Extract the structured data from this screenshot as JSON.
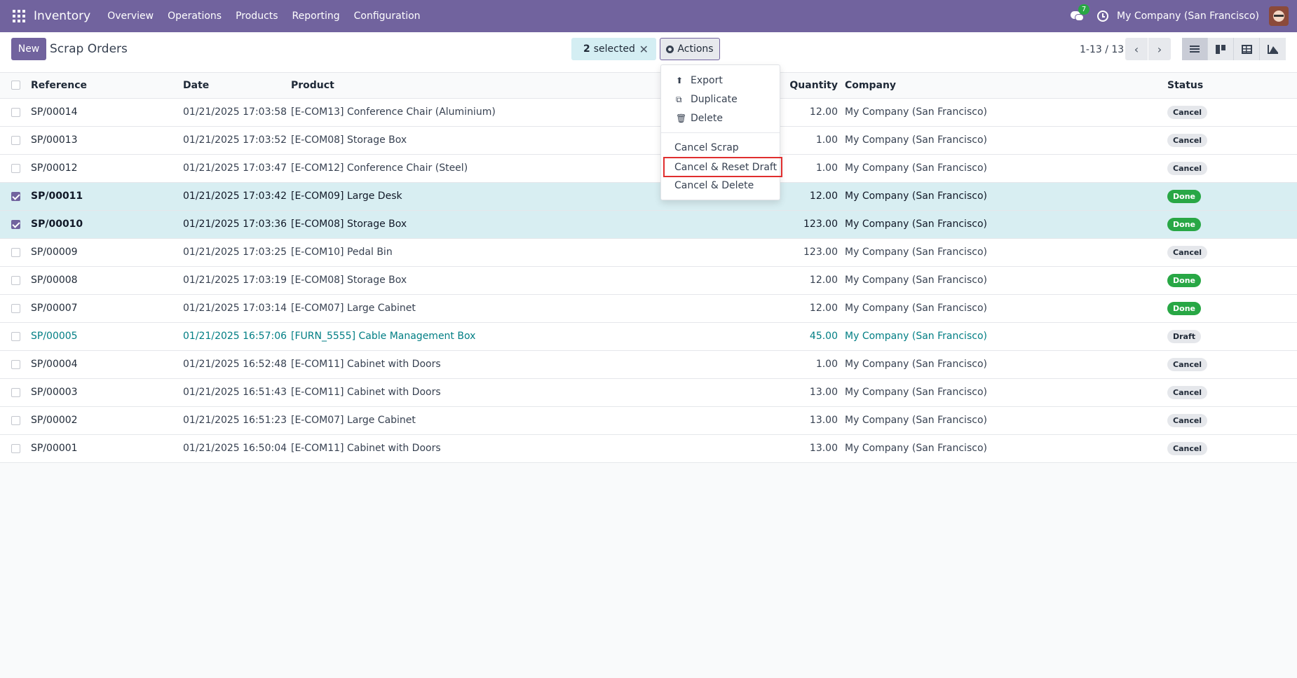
{
  "navbar": {
    "app_name": "Inventory",
    "menu": [
      "Overview",
      "Operations",
      "Products",
      "Reporting",
      "Configuration"
    ],
    "message_count": "7",
    "company": "My Company (San Francisco)"
  },
  "control_panel": {
    "new_label": "New",
    "breadcrumb": "Scrap Orders",
    "selected_count": "2",
    "selected_label": "selected",
    "actions_label": "Actions",
    "pager": "1-13 / 13"
  },
  "table": {
    "headers": {
      "reference": "Reference",
      "date": "Date",
      "product": "Product",
      "quantity": "Quantity",
      "company": "Company",
      "status": "Status"
    },
    "rows": [
      {
        "ref": "SP/00014",
        "date": "01/21/2025 17:03:58",
        "product": "[E-COM13] Conference Chair (Aluminium)",
        "qty": "12.00",
        "company": "My Company (San Francisco)",
        "status": "Cancel"
      },
      {
        "ref": "SP/00013",
        "date": "01/21/2025 17:03:52",
        "product": "[E-COM08] Storage Box",
        "qty": "1.00",
        "company": "My Company (San Francisco)",
        "status": "Cancel"
      },
      {
        "ref": "SP/00012",
        "date": "01/21/2025 17:03:47",
        "product": "[E-COM12] Conference Chair (Steel)",
        "qty": "1.00",
        "company": "My Company (San Francisco)",
        "status": "Cancel"
      },
      {
        "ref": "SP/00011",
        "date": "01/21/2025 17:03:42",
        "product": "[E-COM09] Large Desk",
        "qty": "12.00",
        "company": "My Company (San Francisco)",
        "status": "Done"
      },
      {
        "ref": "SP/00010",
        "date": "01/21/2025 17:03:36",
        "product": "[E-COM08] Storage Box",
        "qty": "123.00",
        "company": "My Company (San Francisco)",
        "status": "Done"
      },
      {
        "ref": "SP/00009",
        "date": "01/21/2025 17:03:25",
        "product": "[E-COM10] Pedal Bin",
        "qty": "123.00",
        "company": "My Company (San Francisco)",
        "status": "Cancel"
      },
      {
        "ref": "SP/00008",
        "date": "01/21/2025 17:03:19",
        "product": "[E-COM08] Storage Box",
        "qty": "12.00",
        "company": "My Company (San Francisco)",
        "status": "Done"
      },
      {
        "ref": "SP/00007",
        "date": "01/21/2025 17:03:14",
        "product": "[E-COM07] Large Cabinet",
        "qty": "12.00",
        "company": "My Company (San Francisco)",
        "status": "Done"
      },
      {
        "ref": "SP/00005",
        "date": "01/21/2025 16:57:06",
        "product": "[FURN_5555] Cable Management Box",
        "qty": "45.00",
        "company": "My Company (San Francisco)",
        "status": "Draft"
      },
      {
        "ref": "SP/00004",
        "date": "01/21/2025 16:52:48",
        "product": "[E-COM11] Cabinet with Doors",
        "qty": "1.00",
        "company": "My Company (San Francisco)",
        "status": "Cancel"
      },
      {
        "ref": "SP/00003",
        "date": "01/21/2025 16:51:43",
        "product": "[E-COM11] Cabinet with Doors",
        "qty": "13.00",
        "company": "My Company (San Francisco)",
        "status": "Cancel"
      },
      {
        "ref": "SP/00002",
        "date": "01/21/2025 16:51:23",
        "product": "[E-COM07] Large Cabinet",
        "qty": "13.00",
        "company": "My Company (San Francisco)",
        "status": "Cancel"
      },
      {
        "ref": "SP/00001",
        "date": "01/21/2025 16:50:04",
        "product": "[E-COM11] Cabinet with Doors",
        "qty": "13.00",
        "company": "My Company (San Francisco)",
        "status": "Cancel"
      }
    ]
  },
  "actions_menu": {
    "export": "Export",
    "duplicate": "Duplicate",
    "delete": "Delete",
    "cancel_scrap": "Cancel Scrap",
    "cancel_reset_draft": "Cancel & Reset Draft",
    "cancel_delete": "Cancel & Delete"
  },
  "colors": {
    "brand": "#71639e",
    "selected_row": "#d8eef2",
    "done_badge": "#28a745",
    "draft_text": "#017e84",
    "highlight_border": "#e02e2e"
  }
}
